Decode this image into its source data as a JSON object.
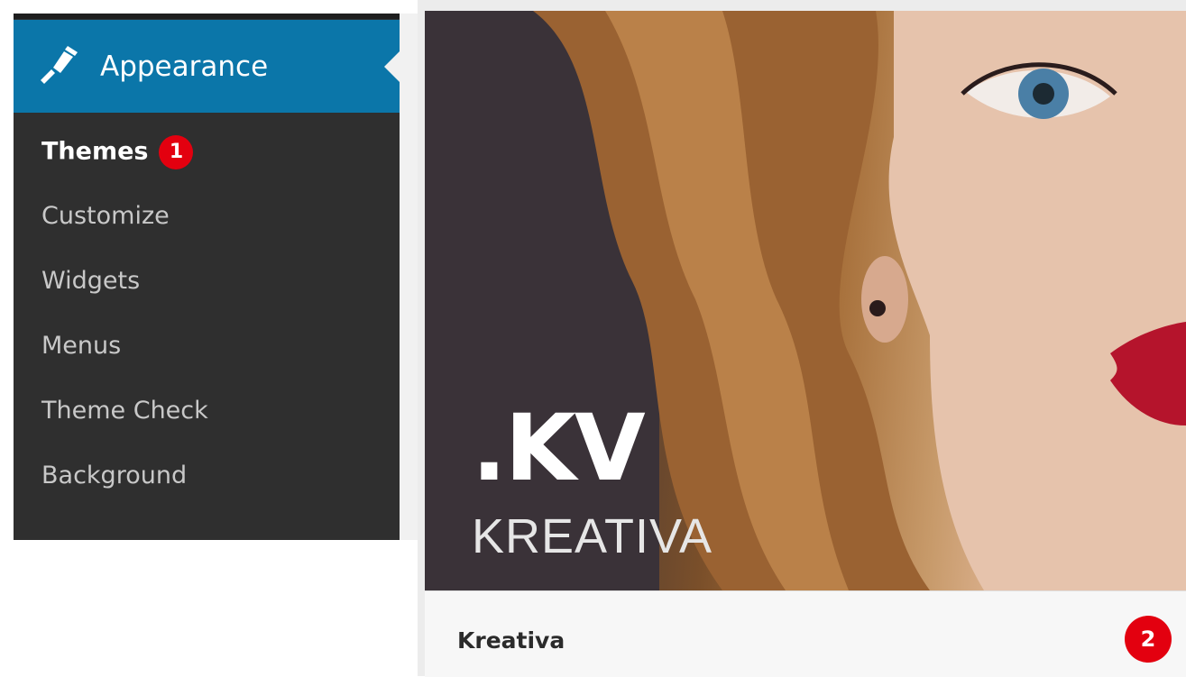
{
  "sidebar": {
    "menu_title": "Appearance",
    "items": [
      {
        "label": "Themes",
        "current": true,
        "badge": "1"
      },
      {
        "label": "Customize"
      },
      {
        "label": "Widgets"
      },
      {
        "label": "Menus"
      },
      {
        "label": "Theme Check"
      },
      {
        "label": "Background"
      }
    ]
  },
  "theme_card": {
    "logo_mark": ".KV",
    "logo_word": "KREATIVA",
    "name": "Kreativa",
    "badge": "2"
  },
  "colors": {
    "menu_active_bg": "#0b76a9",
    "sidebar_bg": "#2f2f2f",
    "badge_red": "#e3000f"
  },
  "icons": {
    "appearance": "paintbrush-icon"
  }
}
